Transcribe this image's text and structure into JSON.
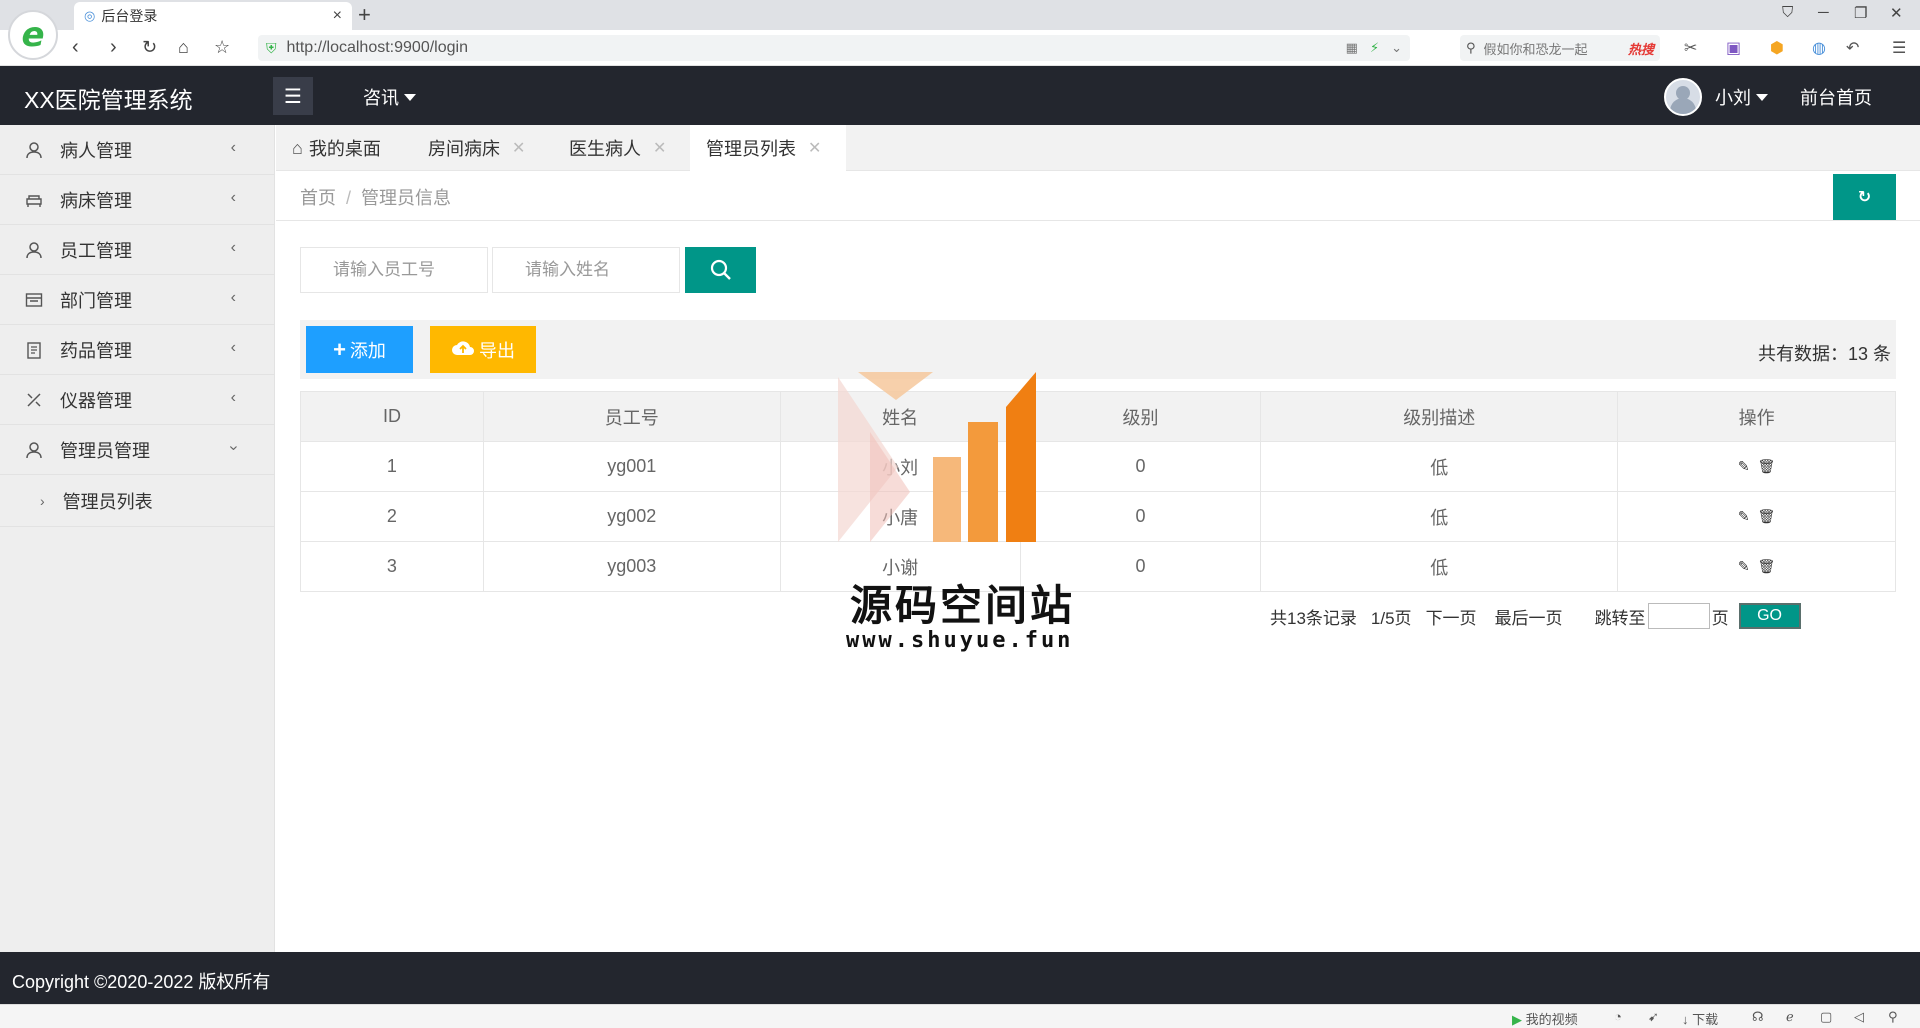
{
  "browser": {
    "tab_title": "后台登录",
    "url": "http://localhost:9900/login",
    "search_placeholder": "假如你和恐龙一起",
    "hot_label": "热搜"
  },
  "header": {
    "logo": "XX医院管理系统",
    "nav_news": "咨讯",
    "user_name": "小刘",
    "front_home": "前台首页"
  },
  "sidebar": {
    "items": [
      {
        "label": "病人管理",
        "icon": "person-icon"
      },
      {
        "label": "病床管理",
        "icon": "bed-icon"
      },
      {
        "label": "员工管理",
        "icon": "staff-icon"
      },
      {
        "label": "部门管理",
        "icon": "department-icon"
      },
      {
        "label": "药品管理",
        "icon": "medicine-icon"
      },
      {
        "label": "仪器管理",
        "icon": "instrument-icon"
      },
      {
        "label": "管理员管理",
        "icon": "admin-icon"
      }
    ],
    "sub_items": [
      {
        "label": "管理员列表"
      }
    ]
  },
  "tabs": [
    {
      "label": "我的桌面"
    },
    {
      "label": "房间病床"
    },
    {
      "label": "医生病人"
    },
    {
      "label": "管理员列表"
    }
  ],
  "breadcrumb": {
    "home": "首页",
    "separator": "/",
    "current": "管理员信息"
  },
  "search": {
    "staff_no_placeholder": "请输入员工号",
    "name_placeholder": "请输入姓名"
  },
  "actions": {
    "add_label": "添加",
    "export_label": "导出",
    "total_label": "共有数据：13 条"
  },
  "table": {
    "columns": [
      "ID",
      "员工号",
      "姓名",
      "级别",
      "级别描述",
      "操作"
    ],
    "rows": [
      {
        "id": "1",
        "staff_no": "yg001",
        "name": "小刘",
        "level": "0",
        "level_desc": "低"
      },
      {
        "id": "2",
        "staff_no": "yg002",
        "name": "小唐",
        "level": "0",
        "level_desc": "低"
      },
      {
        "id": "3",
        "staff_no": "yg003",
        "name": "小谢",
        "level": "0",
        "level_desc": "低"
      }
    ]
  },
  "pagination": {
    "records": "共13条记录",
    "page": "1/5页",
    "next": "下一页",
    "last": "最后一页",
    "jump_to": "跳转至",
    "page_unit": "页",
    "go": "GO"
  },
  "watermark": {
    "text": "源码空间站",
    "url": "www.shuyue.fun"
  },
  "footer": {
    "copyright": "Copyright ©2020-2022 版权所有"
  },
  "status_bar": {
    "my_video": "我的视频",
    "download": "下载"
  },
  "colors": {
    "header_bg": "#23262e",
    "primary": "#009688",
    "add_button": "#1e9fff",
    "export_button": "#ffb800"
  }
}
